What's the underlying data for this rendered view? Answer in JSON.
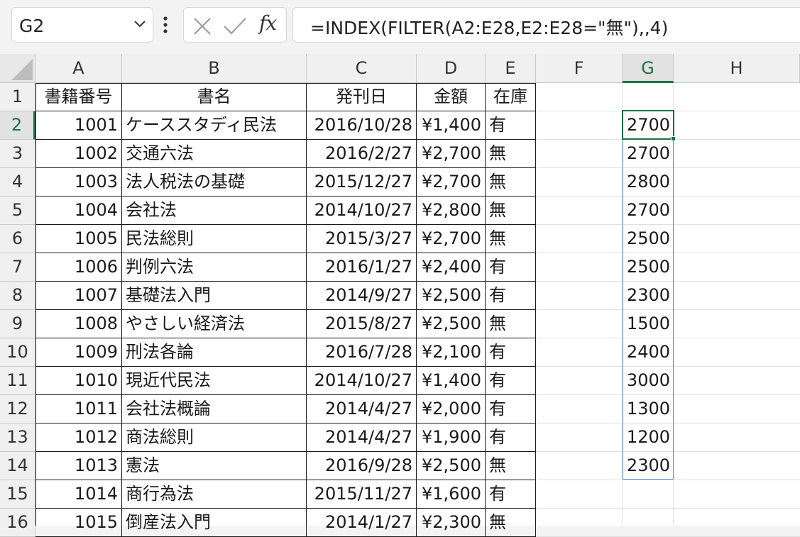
{
  "formula_bar": {
    "name_box": "G2",
    "formula": "=INDEX(FILTER(A2:E28,E2:E28=\"無\"),,4)",
    "fx_label": "fx"
  },
  "columns": [
    "A",
    "B",
    "C",
    "D",
    "E",
    "F",
    "G",
    "H"
  ],
  "row_numbers": [
    "1",
    "2",
    "3",
    "4",
    "5",
    "6",
    "7",
    "8",
    "9",
    "10",
    "11",
    "12",
    "13",
    "14",
    "15",
    "16"
  ],
  "header": [
    "書籍番号",
    "書名",
    "発刊日",
    "金額",
    "在庫"
  ],
  "rows": [
    [
      "1001",
      "ケーススタディ民法",
      "2016/10/28",
      "¥1,400",
      "有"
    ],
    [
      "1002",
      "交通六法",
      "2016/2/27",
      "¥2,700",
      "無"
    ],
    [
      "1003",
      "法人税法の基礎",
      "2015/12/27",
      "¥2,700",
      "無"
    ],
    [
      "1004",
      "会社法",
      "2014/10/27",
      "¥2,800",
      "無"
    ],
    [
      "1005",
      "民法総則",
      "2015/3/27",
      "¥2,700",
      "無"
    ],
    [
      "1006",
      "判例六法",
      "2016/1/27",
      "¥2,400",
      "有"
    ],
    [
      "1007",
      "基礎法入門",
      "2014/9/27",
      "¥2,500",
      "有"
    ],
    [
      "1008",
      "やさしい経済法",
      "2015/8/27",
      "¥2,500",
      "無"
    ],
    [
      "1009",
      "刑法各論",
      "2016/7/28",
      "¥2,100",
      "有"
    ],
    [
      "1010",
      "現近代民法",
      "2014/10/27",
      "¥1,400",
      "有"
    ],
    [
      "1011",
      "会社法概論",
      "2014/4/27",
      "¥2,000",
      "有"
    ],
    [
      "1012",
      "商法総則",
      "2014/4/27",
      "¥1,900",
      "有"
    ],
    [
      "1013",
      "憲法",
      "2016/9/28",
      "¥2,500",
      "無"
    ],
    [
      "1014",
      "商行為法",
      "2015/11/27",
      "¥1,600",
      "有"
    ],
    [
      "1015",
      "倒産法入門",
      "2014/1/27",
      "¥2,300",
      "無"
    ]
  ],
  "spill_g": [
    "2700",
    "2700",
    "2800",
    "2700",
    "2500",
    "2500",
    "2300",
    "1500",
    "2400",
    "3000",
    "1300",
    "1200",
    "2300"
  ],
  "colors": {
    "accent_green": "#1e7145",
    "spill_blue": "#5b8bd0"
  }
}
